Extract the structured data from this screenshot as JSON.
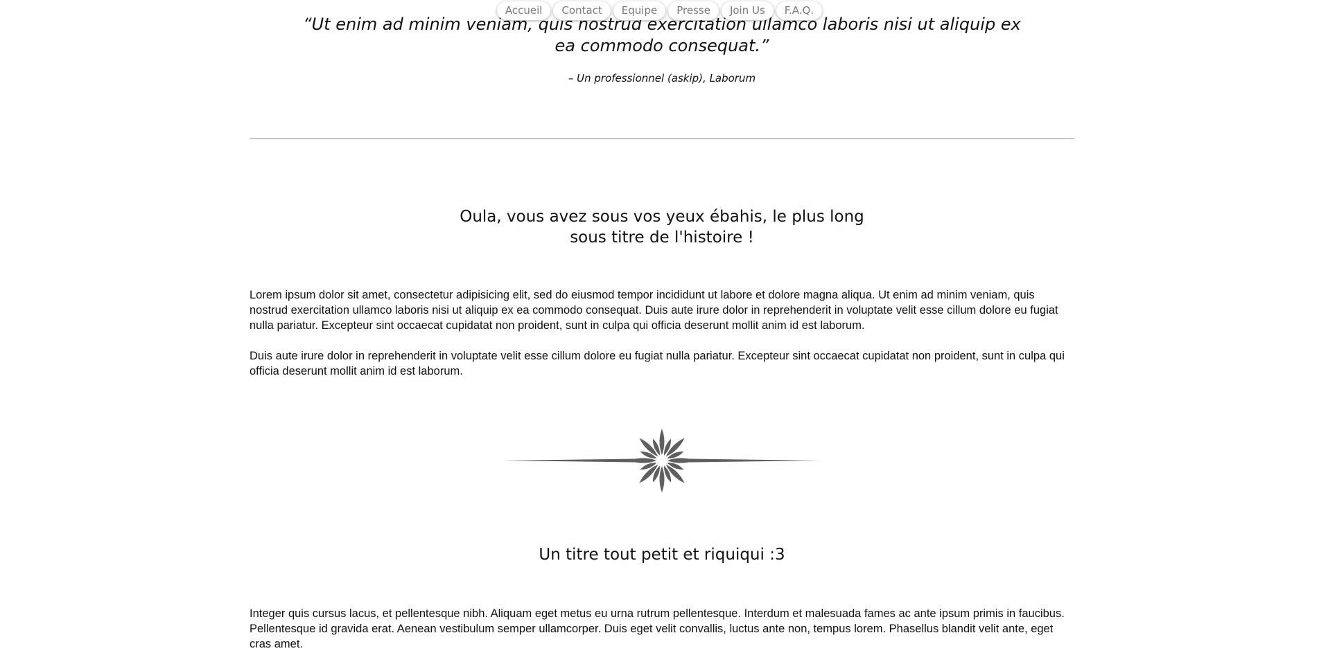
{
  "nav": {
    "items": [
      "Accueil",
      "Contact",
      "Equipe",
      "Presse",
      "Join Us",
      "F.A.Q."
    ]
  },
  "quote": {
    "text": "“Ut enim ad minim veniam, quis nostrud exercitation ullamco laboris nisi ut aliquip ex ea commodo consequat.”",
    "author": "– Un professionnel (askip), Laborum"
  },
  "section1": {
    "title": "Oula, vous avez sous vos yeux ébahis, le plus long sous titre de l'histoire !",
    "paragraphs": [
      "Lorem ipsum dolor sit amet, consectetur adipisicing elit, sed do eiusmod tempor incididunt ut labore et dolore magna aliqua. Ut enim ad minim veniam, quis nostrud exercitation ullamco laboris nisi ut aliquip ex ea commodo consequat. Duis aute irure dolor in reprehenderit in voluptate velit esse cillum dolore eu fugiat nulla pariatur. Excepteur sint occaecat cupidatat non proident, sunt in culpa qui officia deserunt mollit anim id est laborum.",
      "Duis aute irure dolor in reprehenderit in voluptate velit esse cillum dolore eu fugiat nulla pariatur. Excepteur sint occaecat cupidatat non proident, sunt in culpa qui officia deserunt mollit anim id est laborum."
    ]
  },
  "ornament": {
    "icon": "floral-divider-icon",
    "color": "#5f5f5f"
  },
  "section2": {
    "title": "Un titre tout petit et riquiqui :3",
    "paragraphs": [
      "Integer quis cursus lacus, et pellentesque nibh. Aliquam eget metus eu urna rutrum pellentesque. Interdum et malesuada fames ac ante ipsum primis in faucibus. Pellentesque id gravida erat. Aenean vestibulum semper ullamcorper. Duis eget velit convallis, luctus ante non, tempus lorem. Phasellus blandit velit ante, eget cras amet."
    ]
  }
}
